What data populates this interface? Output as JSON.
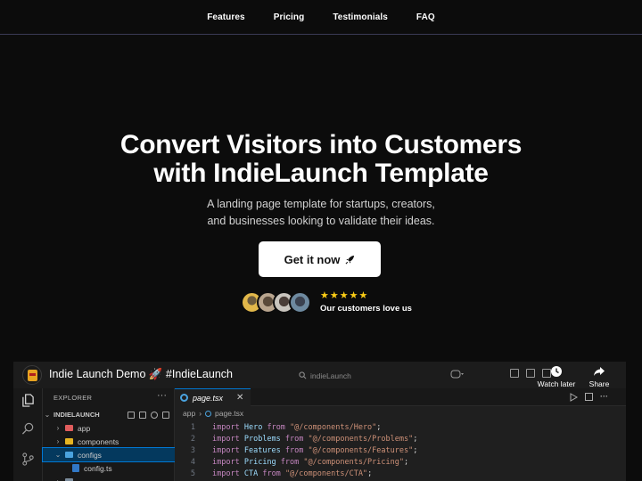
{
  "nav": {
    "items": [
      "Features",
      "Pricing",
      "Testimonials",
      "FAQ"
    ]
  },
  "hero": {
    "title_line1": "Convert Visitors into Customers",
    "title_line2": "with IndieLaunch Template",
    "subtitle_line1": "A landing page template for startups, creators,",
    "subtitle_line2": "and businesses looking to validate their ideas.",
    "cta_label": "Get it now",
    "cta_icon": "rocket-icon",
    "stars": "★★★★★",
    "rating": 5,
    "social_label": "Our customers love us"
  },
  "video": {
    "title": "Indie Launch Demo 🚀 #IndieLaunch",
    "search_text": "indieLaunch",
    "watch_later": "Watch later",
    "share": "Share",
    "editor": {
      "explorer_label": "EXPLORER",
      "project_label": "INDIELAUNCH",
      "tree": [
        {
          "name": "app",
          "chevron": "›",
          "icon_color": "#e05d5d"
        },
        {
          "name": "components",
          "chevron": "›",
          "icon_color": "#e6b422"
        },
        {
          "name": "configs",
          "chevron": "⌄",
          "icon_color": "#4aa3df",
          "selected": true
        },
        {
          "name": "config.ts",
          "chevron": "",
          "icon_color": "#3178c6"
        }
      ],
      "tab_label": "page.tsx",
      "breadcrumb_folder": "app",
      "breadcrumb_file": "page.tsx",
      "code_lines": [
        {
          "num": "1",
          "kw": "import",
          "id": "Hero",
          "from": "from",
          "str": "\"@/components/Hero\"",
          "end": ";"
        },
        {
          "num": "2",
          "kw": "import",
          "id": "Problems",
          "from": "from",
          "str": "\"@/components/Problems\"",
          "end": ";"
        },
        {
          "num": "3",
          "kw": "import",
          "id": "Features",
          "from": "from",
          "str": "\"@/components/Features\"",
          "end": ";"
        },
        {
          "num": "4",
          "kw": "import",
          "id": "Pricing",
          "from": "from",
          "str": "\"@/components/Pricing\"",
          "end": ";"
        },
        {
          "num": "5",
          "kw": "import",
          "id": "CTA",
          "from": "from",
          "str": "\"@/components/CTA\"",
          "end": ";"
        }
      ]
    }
  }
}
